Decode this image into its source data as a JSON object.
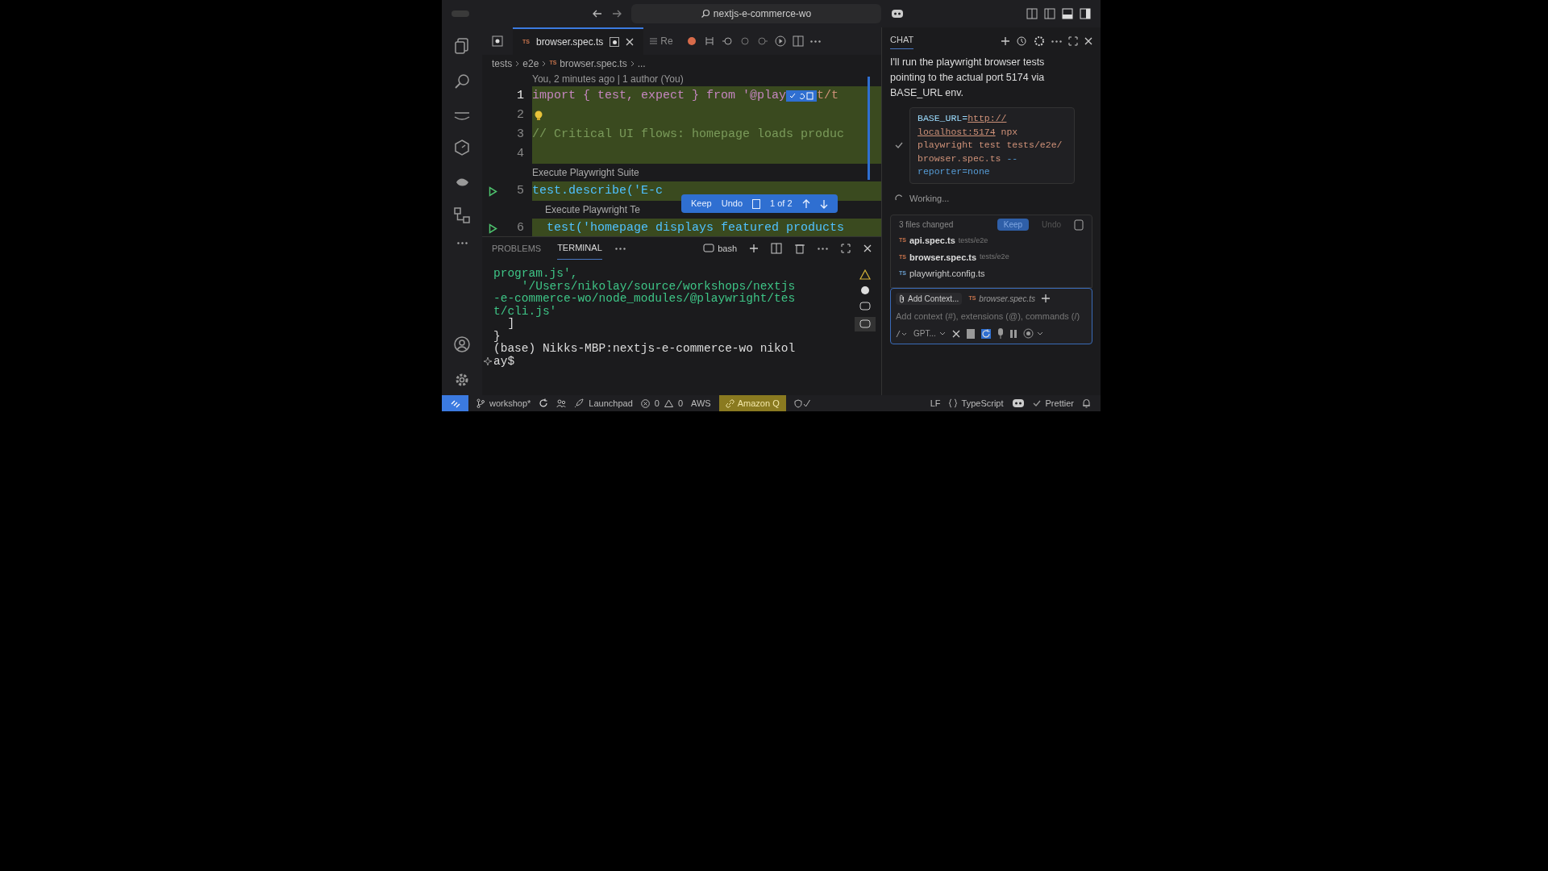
{
  "title_bar": {
    "search": "nextjs-e-commerce-wo"
  },
  "editor_tabs": [
    {
      "label": "browser.spec.ts",
      "icon": "TS",
      "selected": true,
      "modified": true
    },
    {
      "label": "Re",
      "selected": false,
      "modified": false
    }
  ],
  "breadcrumbs": [
    {
      "label": "tests"
    },
    {
      "label": "e2e"
    },
    {
      "label": "browser.spec.ts",
      "icon": "TS"
    },
    {
      "label": "..."
    }
  ],
  "blame": "You, 2 minutes ago | 1 author (You)",
  "code_lines": [
    {
      "number": "1",
      "text": "import { test, expect } from '@play",
      "tail": "t/t",
      "kind": "import",
      "run": false,
      "current": true
    },
    {
      "number": "2",
      "kind": "bulb",
      "run": false,
      "current": false
    },
    {
      "number": "3",
      "text": "// Critical UI flows: homepage loads produc",
      "kind": "comment",
      "run": false,
      "current": false
    },
    {
      "number": "4",
      "kind": "blank",
      "run": false,
      "current": false
    },
    {
      "codelens": "Execute Playwright Suite"
    },
    {
      "number": "5",
      "text": "test.describe('E-c",
      "kind": "code",
      "run": true,
      "current": false
    },
    {
      "codelens": "Execute Playwright Te"
    },
    {
      "number": "6",
      "text": "  test('homepage displays featured products",
      "kind": "code",
      "run": true,
      "current": false
    }
  ],
  "change_bar": {
    "keep": "Keep",
    "undo": "Undo",
    "counter": "1 of 2"
  },
  "panel_tabs": [
    {
      "label": "PROBLEMS",
      "selected": false
    },
    {
      "label": "TERMINAL",
      "selected": true
    }
  ],
  "terminal_shell": "bash",
  "terminal_lines": [
    {
      "text": "program.js',",
      "kind": "string"
    },
    {
      "text": "    '/Users/nikolay/source/workshops/nextjs",
      "kind": "string"
    },
    {
      "text": "-e-commerce-wo/node_modules/@playwright/tes",
      "kind": "string"
    },
    {
      "text": "t/cli.js'",
      "kind": "string"
    },
    {
      "text": "  ]",
      "kind": "plain"
    },
    {
      "text": "}",
      "kind": "plain"
    },
    {
      "text": "(base) Nikks-MBP:nextjs-e-commerce-wo nikol",
      "kind": "plain"
    },
    {
      "text": "ay$",
      "kind": "prompt"
    }
  ],
  "chat": {
    "title": "CHAT",
    "message": "I'll run the playwright browser tests pointing to the actual port 5174 via BASE_URL env.",
    "command": [
      {
        "text": "BASE_URL=",
        "kind": "var"
      },
      {
        "text": "http://",
        "kind": "link"
      },
      {
        "text": "localhost:5174",
        "kind": "link"
      },
      {
        "text": " npx playwright test tests/e2e/ browser.spec.ts",
        "kind": "arg"
      },
      {
        "text": " --reporter=none",
        "kind": "flag"
      }
    ],
    "status": "Working...",
    "files_changed": "3 files changed",
    "keep": "Keep",
    "undo": "Undo",
    "files": [
      {
        "icon": "TS",
        "name": "api.spec.ts",
        "path": "tests/e2e",
        "modified": true
      },
      {
        "icon": "TS",
        "name": "browser.spec.ts",
        "path": "tests/e2e",
        "modified": true
      },
      {
        "icon": "TS",
        "name": "playwright.config.ts",
        "modified": false
      }
    ],
    "add_context": "Add Context...",
    "attached_icon": "TS",
    "attached": "browser.spec.ts",
    "placeholder": "Add context (#), extensions (@), commands (/)",
    "model": "GPT..."
  },
  "status_bar": {
    "branch": "workshop*",
    "launchpad": "Launchpad",
    "errors": "0",
    "warnings": "0",
    "aws": "AWS",
    "amazon_q": "Amazon Q",
    "eol": "LF",
    "language": "TypeScript",
    "prettier": "Prettier"
  }
}
